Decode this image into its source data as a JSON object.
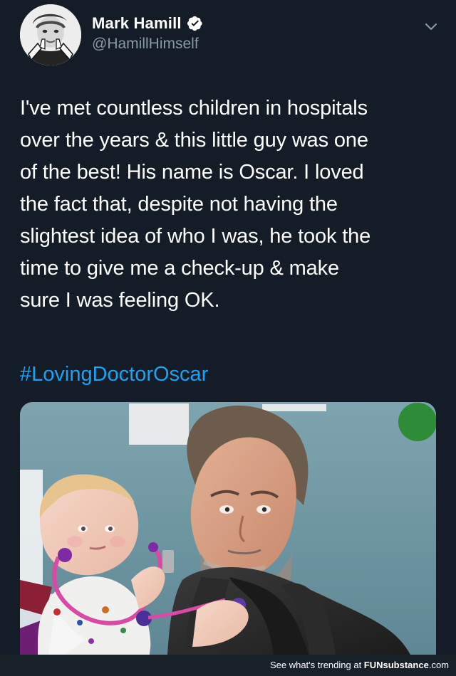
{
  "tweet": {
    "author_name": "Mark Hamill",
    "handle": "@HamillHimself",
    "text": "I've met countless children in hospitals\nover the years & this little guy was one\nof the best! His name is Oscar. I loved\nthe fact that, despite not having the\nslightest idea of who I was, he took the\ntime to give me a check-up & make\nsure I was feeling OK.",
    "hashtag": "#LovingDoctorOscar",
    "verified": true
  },
  "icons": {
    "verified": "verified-badge-icon",
    "menu": "chevron-down-icon"
  },
  "colors": {
    "background": "#131c27",
    "text": "#ffffff",
    "secondary_text": "#8899a6",
    "link": "#1da1f2",
    "verified": "#ffffff"
  },
  "footer": {
    "prefix": "See what's trending at ",
    "brand_fun": "FUN",
    "brand_substance": "substance",
    "brand_domain": ".com"
  }
}
